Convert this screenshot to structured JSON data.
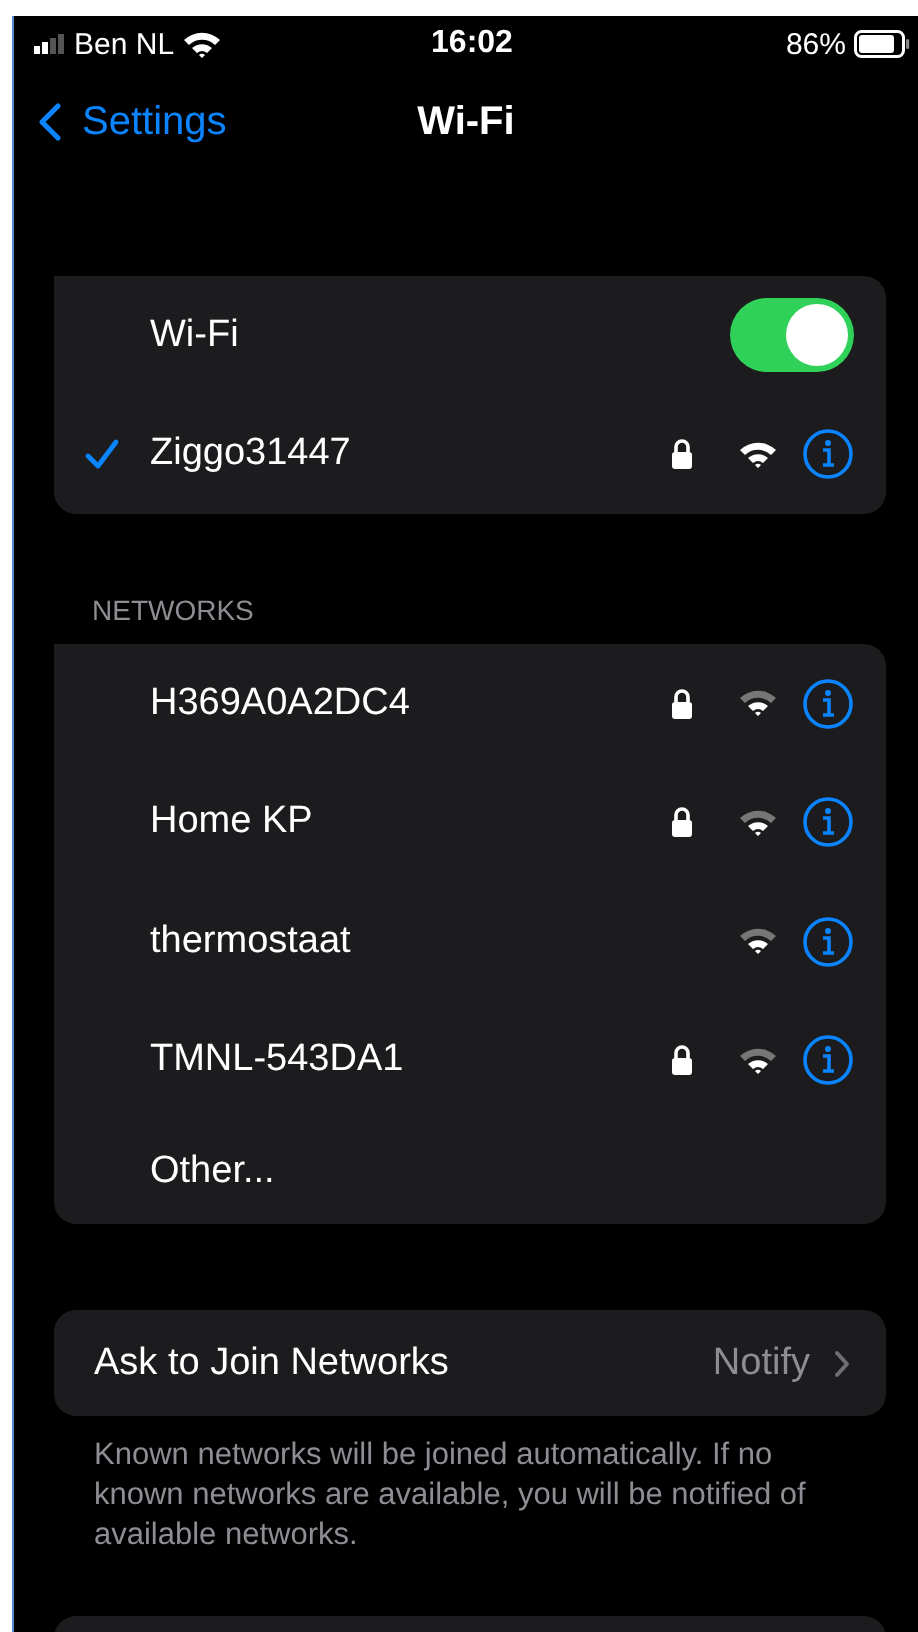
{
  "status_bar": {
    "carrier": "Ben NL",
    "time": "16:02",
    "battery": "86%"
  },
  "nav": {
    "back": "Settings",
    "title": "Wi-Fi"
  },
  "wifi": {
    "label": "Wi-Fi",
    "on": true,
    "current": {
      "name": "Ziggo31447",
      "connected": true,
      "secure": true
    }
  },
  "networks_header": "NETWORKS",
  "networks": [
    {
      "name": "H369A0A2DC4",
      "secure": true
    },
    {
      "name": "Home KP",
      "secure": true
    },
    {
      "name": "thermostaat",
      "secure": false
    },
    {
      "name": "TMNL-543DA1",
      "secure": true
    }
  ],
  "other": "Other...",
  "ask_to_join": {
    "label": "Ask to Join Networks",
    "value": "Notify"
  },
  "ask_to_join_note": "Known networks will be joined automatically. If no known networks are available, you will be notified of available networks."
}
